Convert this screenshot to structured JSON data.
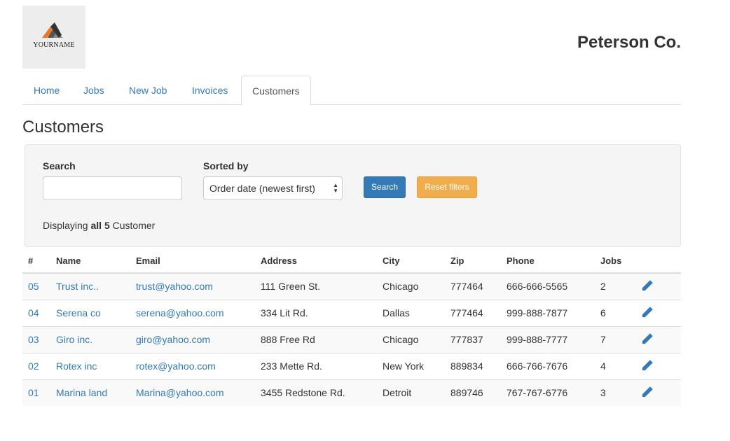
{
  "header": {
    "logo_text": "YOURNAME",
    "company_name": "Peterson Co."
  },
  "nav": {
    "tabs": [
      {
        "label": "Home"
      },
      {
        "label": "Jobs"
      },
      {
        "label": "New Job"
      },
      {
        "label": "Invoices"
      },
      {
        "label": "Customers",
        "active": true
      }
    ]
  },
  "page": {
    "title": "Customers"
  },
  "filters": {
    "search_label": "Search",
    "search_value": "",
    "sort_label": "Sorted by",
    "sort_selected": "Order date (newest first)",
    "search_button": "Search",
    "reset_button": "Reset filters",
    "display_prefix": "Displaying ",
    "display_count": "all 5",
    "display_suffix": " Customer"
  },
  "table": {
    "columns": [
      "#",
      "Name",
      "Email",
      "Address",
      "City",
      "Zip",
      "Phone",
      "Jobs"
    ],
    "rows": [
      {
        "id": "05",
        "name": "Trust inc..",
        "email": "trust@yahoo.com",
        "address": "111 Green St.",
        "city": "Chicago",
        "zip": "777464",
        "phone": "666-666-5565",
        "jobs": "2"
      },
      {
        "id": "04",
        "name": "Serena co",
        "email": "serena@yahoo.com",
        "address": "334 Lit Rd.",
        "city": "Dallas",
        "zip": "777464",
        "phone": "999-888-7877",
        "jobs": "6"
      },
      {
        "id": "03",
        "name": "Giro inc.",
        "email": "giro@yahoo.com",
        "address": "888 Free Rd",
        "city": "Chicago",
        "zip": "777837",
        "phone": "999-888-7777",
        "jobs": "7"
      },
      {
        "id": "02",
        "name": "Rotex inc",
        "email": "rotex@yahoo.com",
        "address": "233 Mette Rd.",
        "city": "New York",
        "zip": "889834",
        "phone": "666-766-7676",
        "jobs": "4"
      },
      {
        "id": "01",
        "name": "Marina land",
        "email": "Marina@yahoo.com",
        "address": "3455 Redstone Rd.",
        "city": "Detroit",
        "zip": "889746",
        "phone": "767-767-6776",
        "jobs": "3"
      }
    ]
  },
  "icons": {
    "edit": "pencil-icon",
    "select_arrows": "updown-arrows-icon"
  },
  "colors": {
    "link": "#337ab7",
    "primary_button": "#337ab7",
    "warning_button": "#f0ad4e",
    "panel_bg": "#f5f5f5"
  }
}
